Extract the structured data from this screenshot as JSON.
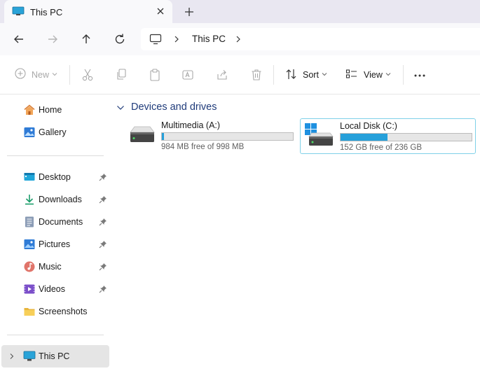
{
  "window": {
    "tab_title": "This PC"
  },
  "address": {
    "segments": [
      "This PC"
    ]
  },
  "toolbar": {
    "new_label": "New",
    "sort_label": "Sort",
    "view_label": "View"
  },
  "sidebar": {
    "quick": [
      {
        "label": "Home"
      },
      {
        "label": "Gallery"
      }
    ],
    "pinned": [
      {
        "label": "Desktop"
      },
      {
        "label": "Downloads"
      },
      {
        "label": "Documents"
      },
      {
        "label": "Pictures"
      },
      {
        "label": "Music"
      },
      {
        "label": "Videos"
      },
      {
        "label": "Screenshots"
      }
    ],
    "this_pc_label": "This PC"
  },
  "content": {
    "group_title": "Devices and drives",
    "drives": [
      {
        "name": "Multimedia (A:)",
        "free_text": "984 MB free of 998 MB",
        "used_fraction": 0.014
      },
      {
        "name": "Local Disk (C:)",
        "free_text": "152 GB free of 236 GB",
        "used_fraction": 0.356
      }
    ]
  },
  "colors": {
    "accent": "#26a0da",
    "selection_border": "#7fd1e8",
    "group_header": "#1f3b7a"
  }
}
